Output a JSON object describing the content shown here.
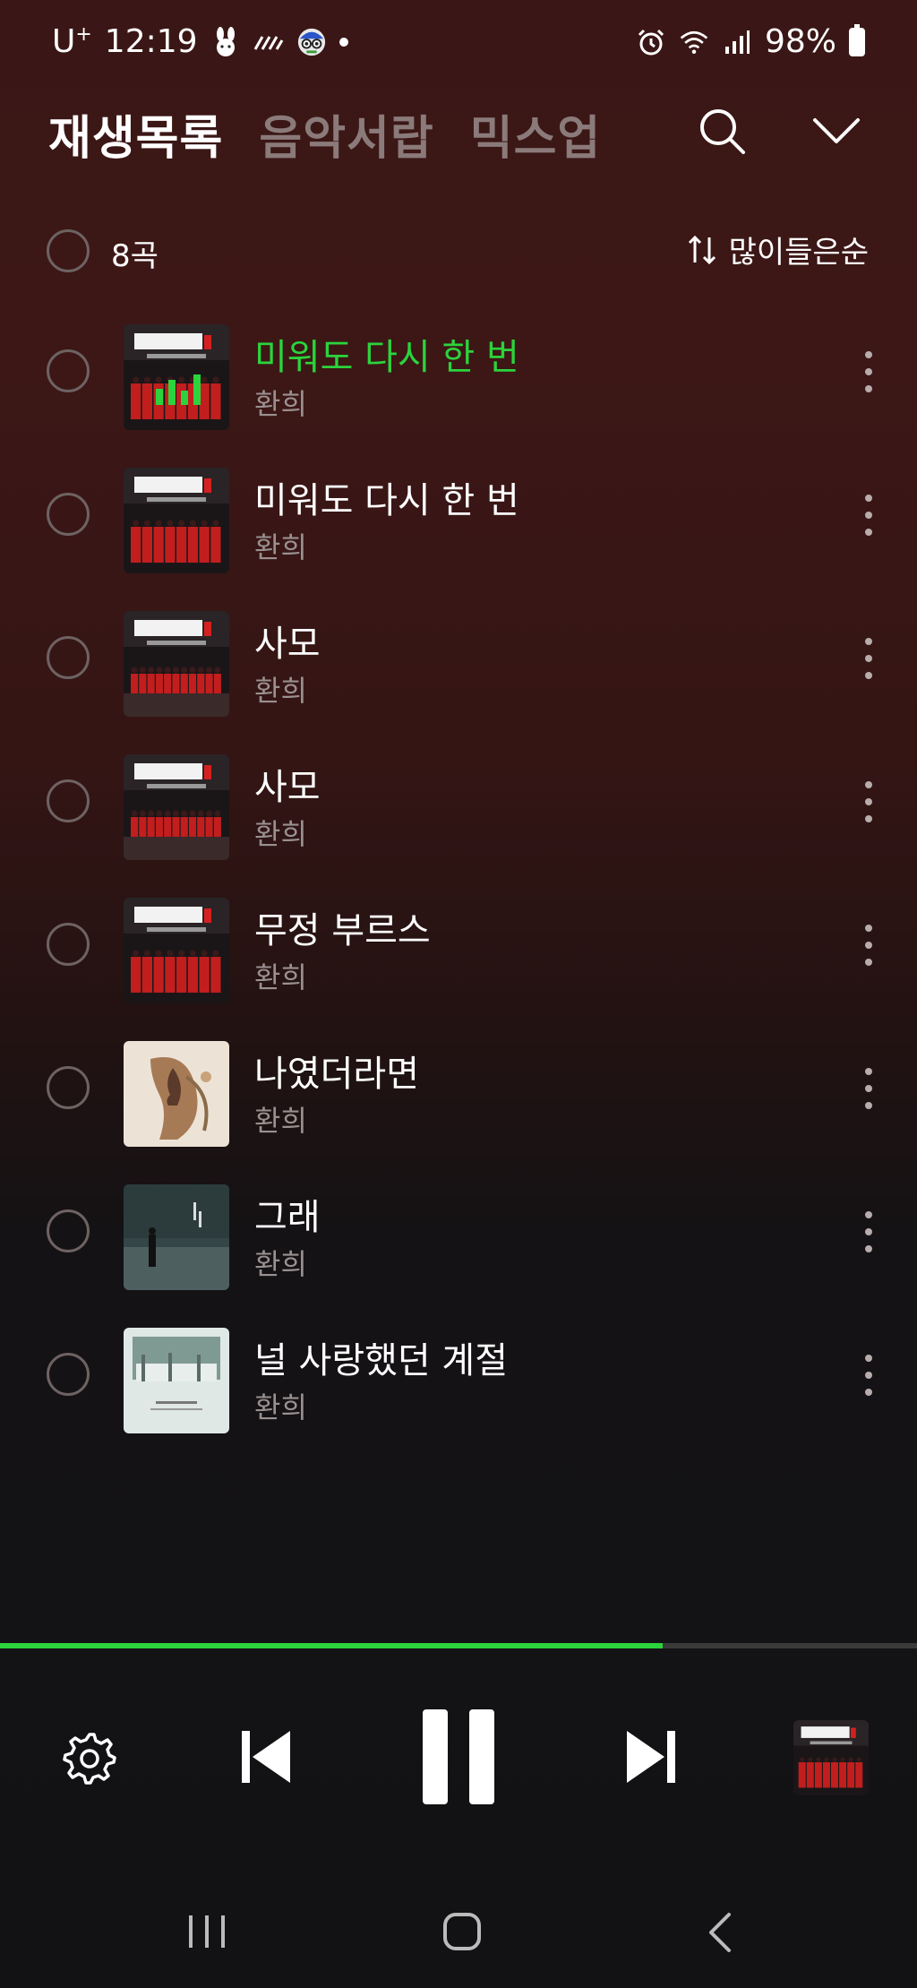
{
  "status": {
    "time": "12:19",
    "carrier": "U",
    "carrier_sup": "+",
    "battery": "98%"
  },
  "tabs": [
    {
      "label": "재생목록",
      "active": true
    },
    {
      "label": "음악서랍",
      "active": false
    },
    {
      "label": "믹스업",
      "active": false
    }
  ],
  "list": {
    "count": "8곡",
    "sort_label": "많이들은순",
    "items": [
      {
        "title": "미워도 다시 한 번",
        "artist": "환희",
        "playing": true,
        "art": "redgroup"
      },
      {
        "title": "미워도 다시 한 번",
        "artist": "환희",
        "playing": false,
        "art": "redgroup"
      },
      {
        "title": "사모",
        "artist": "환희",
        "playing": false,
        "art": "redrow"
      },
      {
        "title": "사모",
        "artist": "환희",
        "playing": false,
        "art": "redrow"
      },
      {
        "title": "무정 부르스",
        "artist": "환희",
        "playing": false,
        "art": "redgroup"
      },
      {
        "title": "나였더라면",
        "artist": "환희",
        "playing": false,
        "art": "portrait"
      },
      {
        "title": "그래",
        "artist": "환희",
        "playing": false,
        "art": "street"
      },
      {
        "title": "널 사랑했던 계절",
        "artist": "환희",
        "playing": false,
        "art": "winter"
      }
    ]
  },
  "player": {
    "progress": 0.723
  },
  "colors": {
    "accent": "#2bd43c",
    "secondary_text": "#9a9090",
    "inactive_tab": "#8b7a7a"
  }
}
